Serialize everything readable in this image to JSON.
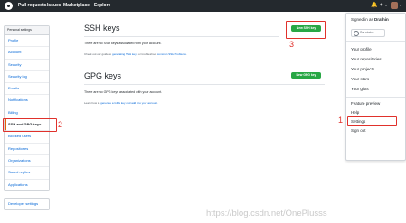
{
  "topbar": {
    "nav": [
      "Pull requests",
      "Issues",
      "Marketplace",
      "Explore"
    ]
  },
  "sidebar": {
    "header": "Personal settings",
    "items": [
      "Profile",
      "Account",
      "Security",
      "Security log",
      "Emails",
      "Notifications",
      "Billing",
      "SSH and GPG keys",
      "Blocked users",
      "Repositories",
      "Organizations",
      "Saved replies",
      "Applications"
    ],
    "developer": "Developer settings"
  },
  "ssh": {
    "title": "SSH keys",
    "button": "New SSH key",
    "empty": "There are no SSH keys associated with your account.",
    "guide_prefix": "Check out our guide to ",
    "guide_link1": "generating SSH keys",
    "guide_mid": " or troubleshoot ",
    "guide_link2": "common SSH Problems",
    "guide_suffix": "."
  },
  "gpg": {
    "title": "GPG keys",
    "button": "New GPG key",
    "empty": "There are no GPG keys associated with your account.",
    "learn_prefix": "Learn how to ",
    "learn_link": "generate a GPG key and add it to your account",
    "learn_suffix": "."
  },
  "dropdown": {
    "signed_in_prefix": "Signed in as ",
    "username": "Drathin",
    "set_status": "Set status",
    "items_a": [
      "Your profile",
      "Your repositories",
      "Your projects",
      "Your stars",
      "Your gists"
    ],
    "items_b": [
      "Feature preview",
      "Help",
      "Settings",
      "Sign out"
    ]
  },
  "annotations": {
    "one": "1",
    "two": "2",
    "three": "3"
  },
  "watermark": "https://blog.csdn.net/OnePlusss"
}
